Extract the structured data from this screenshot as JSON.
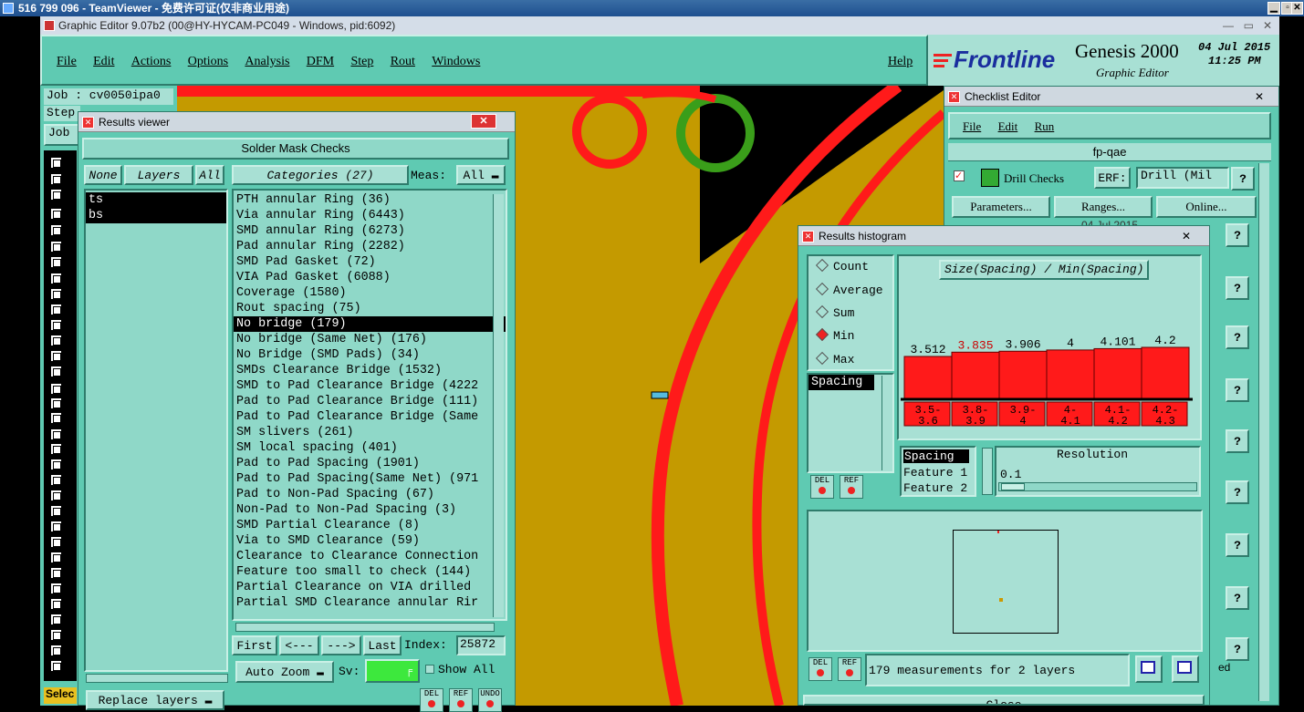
{
  "teamviewer": {
    "title": "516 799 096 - TeamViewer - 免费许可证(仅非商业用途)"
  },
  "window": {
    "title": "Graphic Editor 9.07b2 (00@HY-HYCAM-PC049 - Windows, pid:6092)"
  },
  "menu": [
    "File",
    "Edit",
    "Actions",
    "Options",
    "Analysis",
    "DFM",
    "Step",
    "Rout",
    "Windows"
  ],
  "help": "Help",
  "brand": {
    "logo": "Frontline",
    "product": "Genesis 2000",
    "subtitle": "Graphic Editor",
    "date": "04 Jul 2015",
    "time": "11:25 PM"
  },
  "left": {
    "job": "Job : cv0050ipa0",
    "step": "Step",
    "job_btn": "Job",
    "select": "Selec"
  },
  "results_viewer": {
    "title": "Results viewer",
    "heading": "Solder Mask Checks",
    "none": "None",
    "layers": "Layers",
    "all": "All",
    "categories_btn": "Categories (27)",
    "meas_label": "Meas:",
    "meas_value": "All",
    "layer_list": [
      "ts",
      "bs"
    ],
    "categories": [
      "PTH annular Ring (36)",
      "Via annular Ring (6443)",
      "SMD annular Ring (6273)",
      "Pad annular Ring (2282)",
      "SMD Pad Gasket (72)",
      "VIA Pad Gasket (6088)",
      "Coverage (1580)",
      "Rout spacing (75)",
      "No bridge (179)",
      "No bridge (Same Net) (176)",
      "No Bridge (SMD Pads) (34)",
      "SMDs Clearance Bridge (1532)",
      "SMD to Pad Clearance Bridge (4222",
      "Pad to Pad Clearance Bridge (111)",
      "Pad to Pad Clearance Bridge (Same",
      "SM slivers (261)",
      "SM local spacing (401)",
      "Pad to Pad Spacing (1901)",
      "Pad to Pad Spacing(Same Net) (971",
      "Pad to Non-Pad Spacing (67)",
      "Non-Pad to Non-Pad Spacing (3)",
      "SMD Partial Clearance (8)",
      "Via to SMD Clearance (59)",
      "Clearance to Clearance Connection",
      "Feature too small to check (144)",
      "Partial Clearance on VIA drilled",
      "Partial SMD Clearance annular Rir"
    ],
    "selected_index": 8,
    "first": "First",
    "prev": "<---",
    "next": "--->",
    "last": "Last",
    "index_label": "Index:",
    "index_value": "25872",
    "auto_zoom": "Auto Zoom",
    "sv_label": "Sv:",
    "show_all": "Show All",
    "replace_layers": "Replace layers",
    "del": "DEL",
    "ref": "REF",
    "undo": "UNDO"
  },
  "histogram": {
    "title": "Results histogram",
    "options": [
      "Count",
      "Average",
      "Sum",
      "Min",
      "Max"
    ],
    "selected_option": "Min",
    "list": [
      "Spacing"
    ],
    "chart_title": "Size(Spacing) / Min(Spacing)",
    "del": "DEL",
    "ref": "REF",
    "fields": [
      "Spacing",
      "Feature 1",
      "Feature 2"
    ],
    "resolution_label": "Resolution",
    "resolution_value": "0.1",
    "status": "179 measurements for 2 layers",
    "close": "Close",
    "colors": {
      "bar": "#ff1a1a",
      "highlight": "#cc0000"
    }
  },
  "chart_data": {
    "type": "bar",
    "title": "Size(Spacing) / Min(Spacing)",
    "categories": [
      "3.5-3.6",
      "3.8-3.9",
      "3.9-4",
      "4-4.1",
      "4.1-4.2",
      "4.2-4.3"
    ],
    "category_lines": [
      [
        "3.5-",
        "3.6"
      ],
      [
        "3.8-",
        "3.9"
      ],
      [
        "3.9-",
        "4"
      ],
      [
        "4-",
        "4.1"
      ],
      [
        "4.1-",
        "4.2"
      ],
      [
        "4.2-",
        "4.3"
      ]
    ],
    "value_labels": [
      "3.512",
      "3.835",
      "3.906",
      "4",
      "4.101",
      "4.2"
    ],
    "series": [
      {
        "values": [
          3.512,
          3.835,
          3.906,
          4,
          4.101,
          4.2
        ]
      }
    ],
    "highlight_index": 1,
    "ylim": [
      0,
      4.2
    ]
  },
  "checklist": {
    "title": "Checklist Editor",
    "menu": [
      "File",
      "Edit",
      "Run"
    ],
    "name": "fp-qae",
    "row_label": "Drill Checks",
    "erf_label": "ERF:",
    "erf_value": "Drill (Mil",
    "help": "?",
    "buttons": [
      "Parameters...",
      "Ranges...",
      "Online..."
    ],
    "partial_text": [
      "04 Jul 2015",
      "ed"
    ]
  },
  "colors": {
    "teal": "#5fcab2",
    "board": "#c49a00",
    "trace": "#ff1a1a",
    "ring": "#3a9e1a"
  }
}
